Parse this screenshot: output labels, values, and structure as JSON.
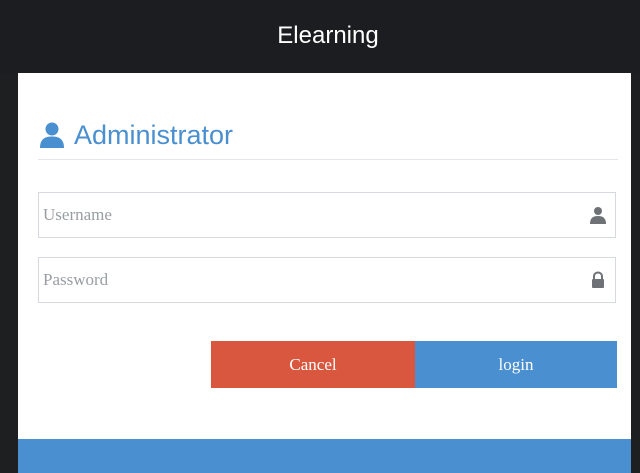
{
  "header": {
    "app_title": "Elearning"
  },
  "login_form": {
    "heading": "Administrator",
    "username": {
      "placeholder": "Username",
      "value": "",
      "icon": "user-icon"
    },
    "password": {
      "placeholder": "Password",
      "value": "",
      "icon": "lock-icon"
    },
    "cancel_label": "Cancel",
    "login_label": "login"
  },
  "colors": {
    "accent": "#4a8fcf",
    "cancel": "#d9573f",
    "header_bg": "#1c1d20"
  }
}
